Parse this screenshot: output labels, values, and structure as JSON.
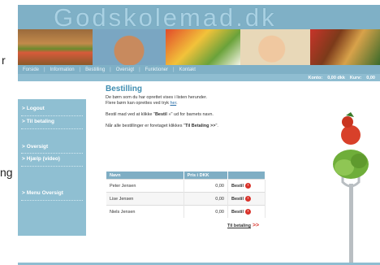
{
  "edge": {
    "left_text_top": "r",
    "left_text_mid": "ng"
  },
  "header": {
    "logo": "Godskolemad.dk"
  },
  "nav": [
    "Forside",
    "Information",
    "Bestilling",
    "Oversigt",
    "Funktioner",
    "Kontakt"
  ],
  "cart": {
    "kontor_label": "Konto:",
    "kontor_value": "0,00 dkk",
    "kurv_label": "Kurv:",
    "kurv_value": "0,00"
  },
  "sidebar": [
    {
      "label": "Logout"
    },
    {
      "label": "Til betaling"
    },
    {
      "label": "Oversigt"
    },
    {
      "label": "Hjælp (video)"
    },
    {
      "label": "Menu Oversigt"
    }
  ],
  "main": {
    "title": "Bestilling",
    "intro1": "De børn som du har oprettet vises i listen herunder.",
    "intro2_pre": "Flere børn kan oprettes ved tryk ",
    "intro2_link": "her",
    "intro2_post": ".",
    "para2_pre": "Bestil mad ved at klikke \"",
    "para2_bold": "Bestil",
    "para2_post": " »\" ud for barnets navn.",
    "para3_pre": "Når alle bestillinger er foretaget klikkes \"",
    "para3_bold": "Til Betaling >>",
    "para3_post": "\"."
  },
  "table": {
    "headers": [
      "Navn",
      "Pris i DKK",
      ""
    ],
    "rows": [
      {
        "name": "Peter Jensen",
        "price": "0,00",
        "action": "Bestil"
      },
      {
        "name": "Lise Jensen",
        "price": "0,00",
        "action": "Bestil"
      },
      {
        "name": "Niels Jensen",
        "price": "0,00",
        "action": "Bestil"
      }
    ]
  },
  "checkout": {
    "label": "Til betaling",
    "arrows": ">>"
  }
}
